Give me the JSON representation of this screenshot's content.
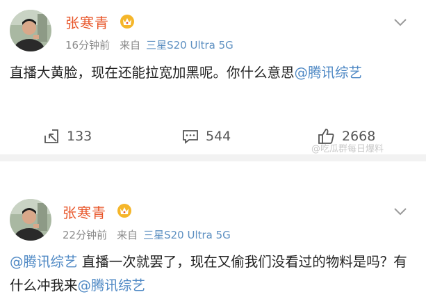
{
  "posts": [
    {
      "username": "张寒青",
      "time": "16分钟前",
      "from_label": "来自",
      "device": "三星S20 Ultra 5G",
      "text_plain": "直播大黄脸，现在还能拉宽加黑呢。你什么意思",
      "mention": "@腾讯综艺",
      "actions": {
        "repost_count": "133",
        "comment_count": "544",
        "like_count": "2668"
      }
    },
    {
      "username": "张寒青",
      "time": "22分钟前",
      "from_label": "来自",
      "device": "三星S20 Ultra 5G",
      "mention_lead": "@腾讯综艺",
      "text_plain": " 直播一次就罢了，现在又偷我们没看过的物料是吗？有什么冲我来",
      "mention_tail": "@腾讯综艺"
    }
  ],
  "watermark": "@吃瓜群每日爆料",
  "colors": {
    "username": "#e8562a",
    "mention": "#4e88c4",
    "device": "#5c8fc1",
    "meta": "#8a8a8a",
    "separator": "#f2f2f2"
  },
  "icons": [
    "crown-badge-icon",
    "chevron-down-icon",
    "repost-icon",
    "comment-icon",
    "like-icon"
  ]
}
